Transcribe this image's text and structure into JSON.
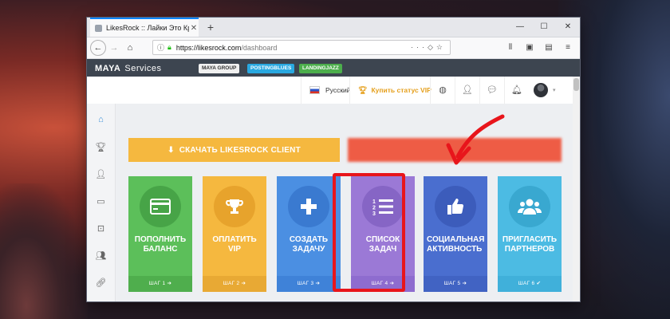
{
  "browser": {
    "tab_title": "LikesRock :: Лайки Это Круто!",
    "url_domain": "https://likesrock.com",
    "url_path": "/dashboard"
  },
  "site": {
    "logo": "MAYA",
    "logo_suffix": "Services",
    "brands": [
      "MAYA GROUP",
      "POSTINGBLUES",
      "LANDINGJAZZ"
    ],
    "language": "Русский",
    "vip_label": "Купить статус VIP"
  },
  "actions": {
    "download_label": "СКАЧАТЬ LIKESROCK CLIENT"
  },
  "cards": [
    {
      "title": "ПОПОЛНИТЬ\nБАЛАНС",
      "step": "ШАГ 1",
      "icon": "credit-card-icon"
    },
    {
      "title": "ОПЛАТИТЬ\nVIP",
      "step": "ШАГ 2",
      "icon": "trophy-icon"
    },
    {
      "title": "СОЗДАТЬ\nЗАДАЧУ",
      "step": "ШАГ 3",
      "icon": "plus-icon"
    },
    {
      "title": "СПИСОК\nЗАДАЧ",
      "step": "ШАГ 4",
      "icon": "list-ol-icon"
    },
    {
      "title": "СОЦИАЛЬНАЯ\nАКТИВНОСТЬ",
      "step": "ШАГ 5",
      "icon": "thumbs-up-icon"
    },
    {
      "title": "ПРИГЛАСИТЬ\nПАРТНЕРОВ",
      "step": "ШАГ 6",
      "icon": "users-icon"
    }
  ],
  "colors": {
    "highlight": "#e8151b",
    "download": "#f5b83f"
  }
}
